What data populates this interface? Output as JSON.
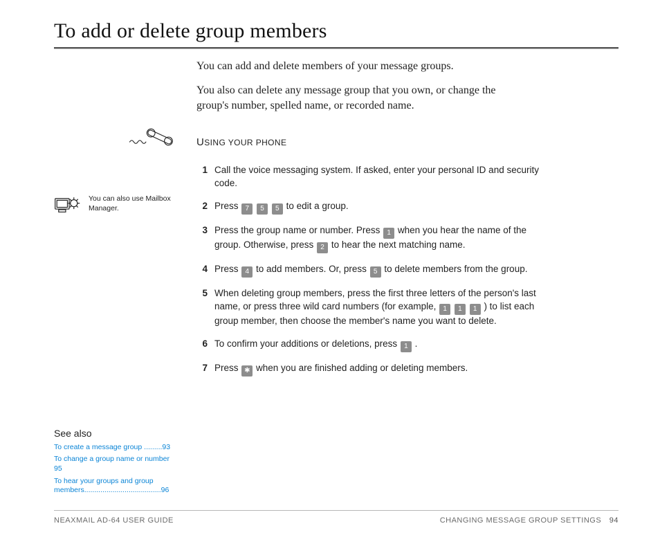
{
  "title": "To add or delete group members",
  "intro": {
    "p1": "You can add and delete members of your message groups.",
    "p2": "You also can delete any message group that you own, or change the group's number, spelled name, or recorded name."
  },
  "section_label": "Using your phone",
  "tip_text": "You can also use Mailbox Manager.",
  "steps": {
    "s1": {
      "num": "1",
      "text": "Call the voice messaging system. If asked, enter your personal ID and security code."
    },
    "s2": {
      "num": "2",
      "pre": "Press ",
      "keys": [
        "7",
        "5",
        "5"
      ],
      "post": " to edit a group."
    },
    "s3": {
      "num": "3",
      "a": "Press the group name or number. Press ",
      "k1": "1",
      "b": " when you hear the name of the group. Otherwise, press ",
      "k2": "2",
      "c": " to hear the next matching name."
    },
    "s4": {
      "num": "4",
      "a": "Press ",
      "k1": "4",
      "b": " to add members. Or, press ",
      "k2": "5",
      "c": " to delete members from the group."
    },
    "s5": {
      "num": "5",
      "a": "When deleting group members, press the first three letters of the person's last name, or press three wild card numbers (for example, ",
      "keys": [
        "1",
        "1",
        "1"
      ],
      "b": ") to list each group member, then choose the member's name you want to delete."
    },
    "s6": {
      "num": "6",
      "a": "To confirm your additions or deletions, press ",
      "k1": "1",
      "b": "."
    },
    "s7": {
      "num": "7",
      "a": "Press ",
      "k1": "✱",
      "b": " when you are finished adding or deleting members."
    }
  },
  "see_also": {
    "heading": "See also",
    "links": [
      "To create a message group .........93",
      "To change a group name or number  95",
      "To hear your groups and group members......................................96"
    ]
  },
  "footer": {
    "left": "NEAXMAIL AD-64 USER GUIDE",
    "right": "CHANGING MESSAGE GROUP SETTINGS",
    "page": "94"
  }
}
